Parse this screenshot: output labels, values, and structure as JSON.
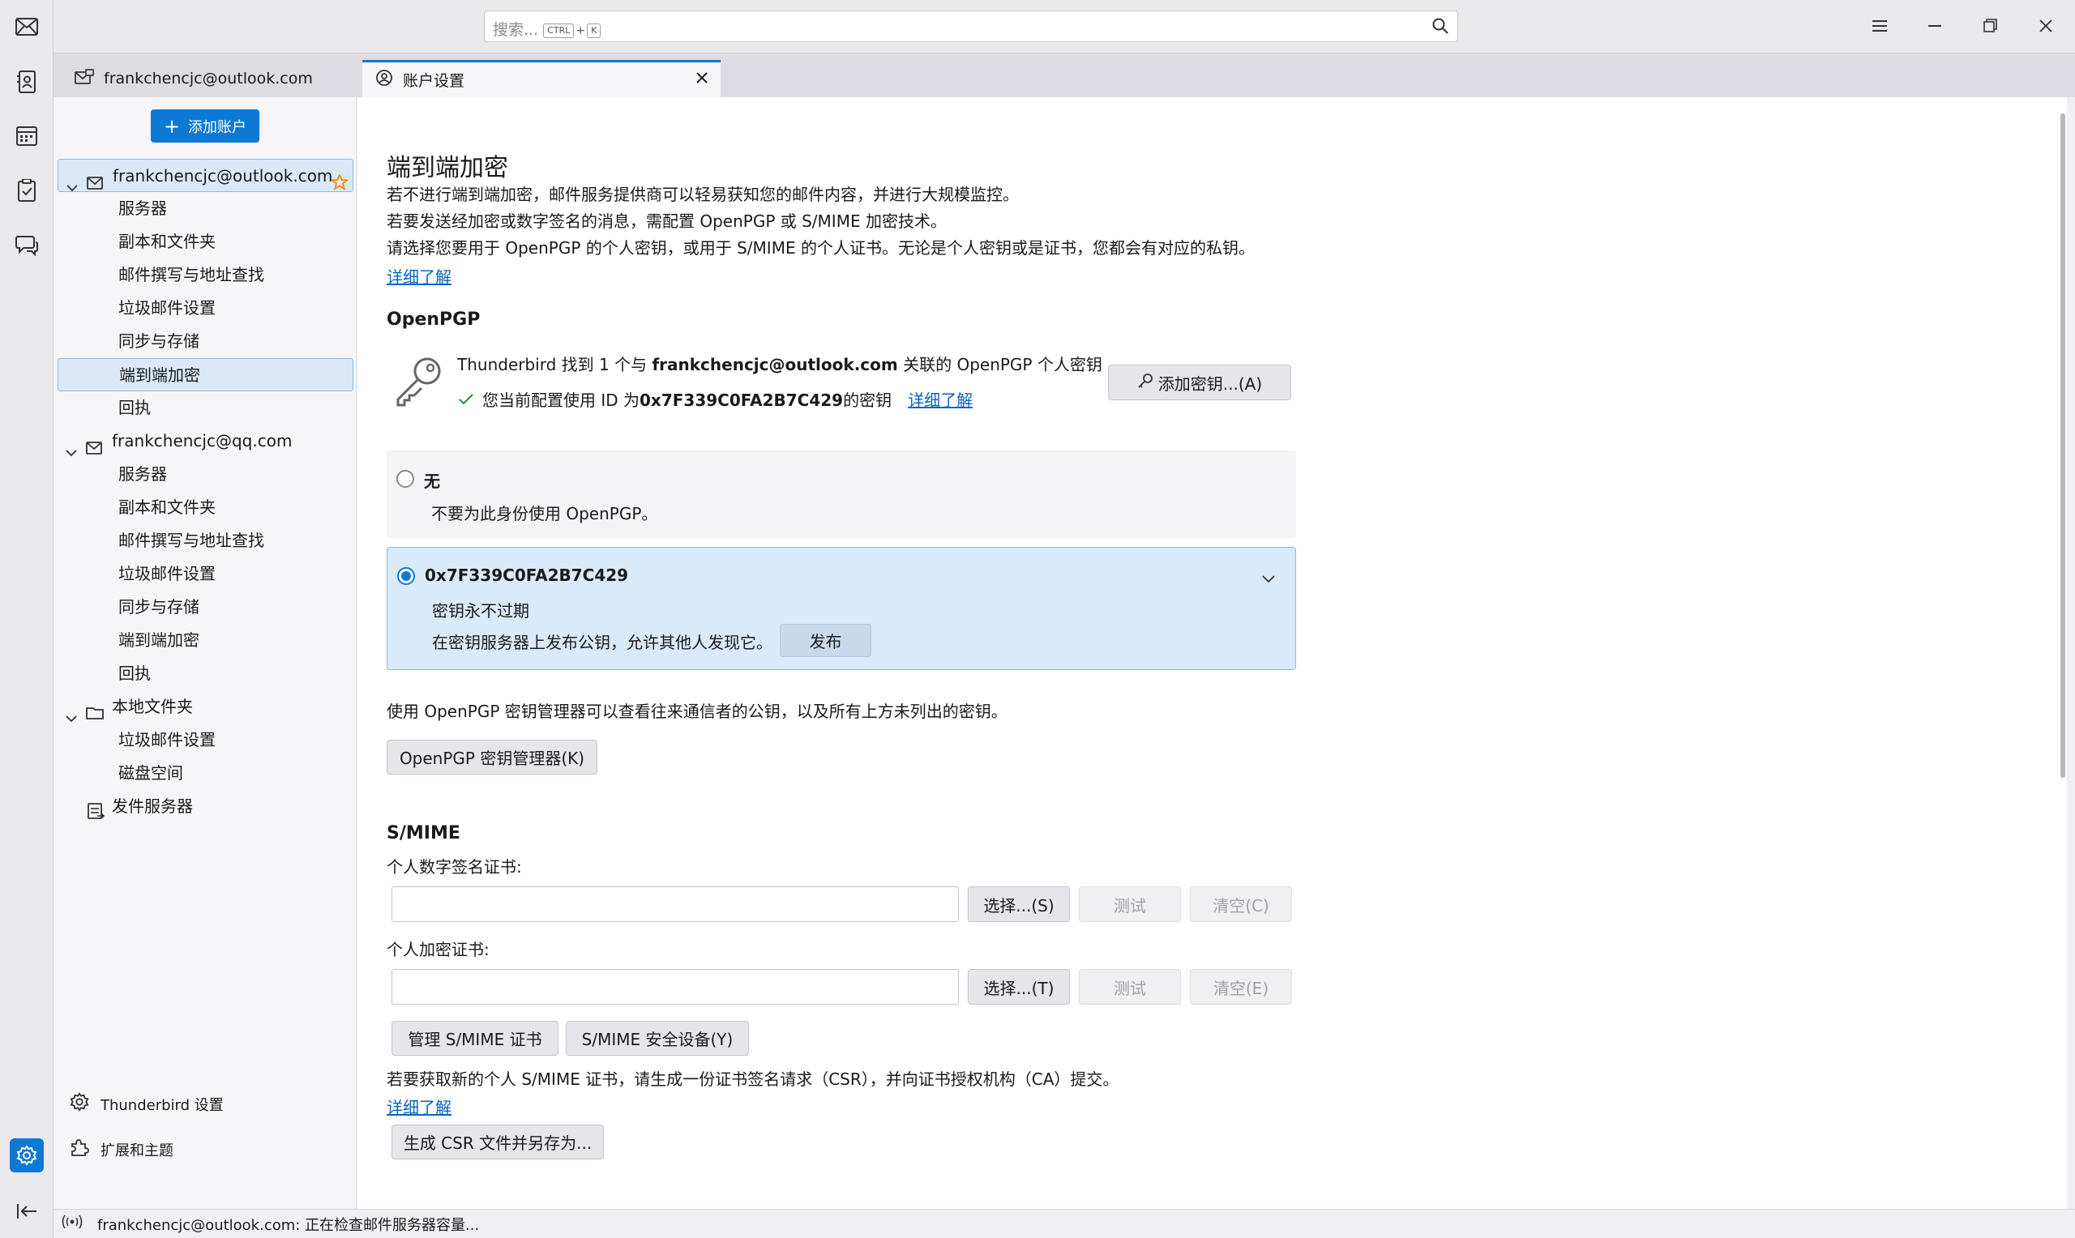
{
  "search": {
    "placeholder": "搜索...",
    "key1": "CTRL",
    "plus": "+",
    "key2": "K"
  },
  "tabs": [
    {
      "label": "frankchencjc@outlook.com"
    },
    {
      "label": "账户设置"
    }
  ],
  "sidebar": {
    "add_account": "添加账户",
    "accounts": [
      {
        "name": "frankchencjc@outlook.com",
        "items": [
          "服务器",
          "副本和文件夹",
          "邮件撰写与地址查找",
          "垃圾邮件设置",
          "同步与存储",
          "端到端加密",
          "回执"
        ]
      },
      {
        "name": "frankchencjc@qq.com",
        "items": [
          "服务器",
          "副本和文件夹",
          "邮件撰写与地址查找",
          "垃圾邮件设置",
          "同步与存储",
          "端到端加密",
          "回执"
        ]
      },
      {
        "name": "本地文件夹",
        "items": [
          "垃圾邮件设置",
          "磁盘空间"
        ]
      }
    ],
    "outgoing": "发件服务器",
    "settings": "Thunderbird 设置",
    "addons": "扩展和主题"
  },
  "main": {
    "title": "端到端加密",
    "intro": [
      "若不进行端到端加密，邮件服务提供商可以轻易获知您的邮件内容，并进行大规模监控。",
      "若要发送经加密或数字签名的消息，需配置 OpenPGP 或 S/MIME 加密技术。",
      "请选择您要用于 OpenPGP 的个人密钥，或用于 S/MIME 的个人证书。无论是个人密钥或是证书，您都会有对应的私钥。"
    ],
    "learn_more": "详细了解",
    "openpgp": {
      "heading": "OpenPGP",
      "found_pre": "Thunderbird 找到 1 个与 ",
      "found_email": "frankchencjc@outlook.com",
      "found_post": " 关联的 OpenPGP 个人密钥",
      "config_pre": "您当前配置使用 ID 为 ",
      "config_id": "0x7F339C0FA2B7C429",
      "config_post": " 的密钥",
      "learn_more": "详细了解",
      "add_key": "添加密钥...(A)",
      "none_label": "无",
      "none_desc": "不要为此身份使用 OpenPGP。",
      "key_id": "0x7F339C0FA2B7C429",
      "key_expiry": "密钥永不过期",
      "publish_desc": "在密钥服务器上发布公钥，允许其他人发现它。",
      "publish": "发布",
      "manager_desc": "使用 OpenPGP 密钥管理器可以查看往来通信者的公钥，以及所有上方未列出的密钥。",
      "manager_btn": "OpenPGP 密钥管理器(K)"
    },
    "smime": {
      "heading": "S/MIME",
      "sign_label": "个人数字签名证书:",
      "enc_label": "个人加密证书:",
      "select_s": "选择...(S)",
      "select_t": "选择...(T)",
      "test": "测试",
      "clear_c": "清空(C)",
      "clear_e": "清空(E)",
      "manage": "管理 S/MIME 证书",
      "devices": "S/MIME 安全设备(Y)",
      "csr_desc": "若要获取新的个人 S/MIME 证书，请生成一份证书签名请求（CSR），并向证书授权机构（CA）提交。",
      "learn_more": "详细了解",
      "csr_btn": "生成 CSR 文件并另存为..."
    }
  },
  "status": "frankchencjc@outlook.com: 正在检查邮件服务器容量...",
  "colors": {
    "accent": "#0e78d5",
    "link": "#0b62c4",
    "selected_bg": "#d9eafb",
    "star": "#f08a00"
  }
}
